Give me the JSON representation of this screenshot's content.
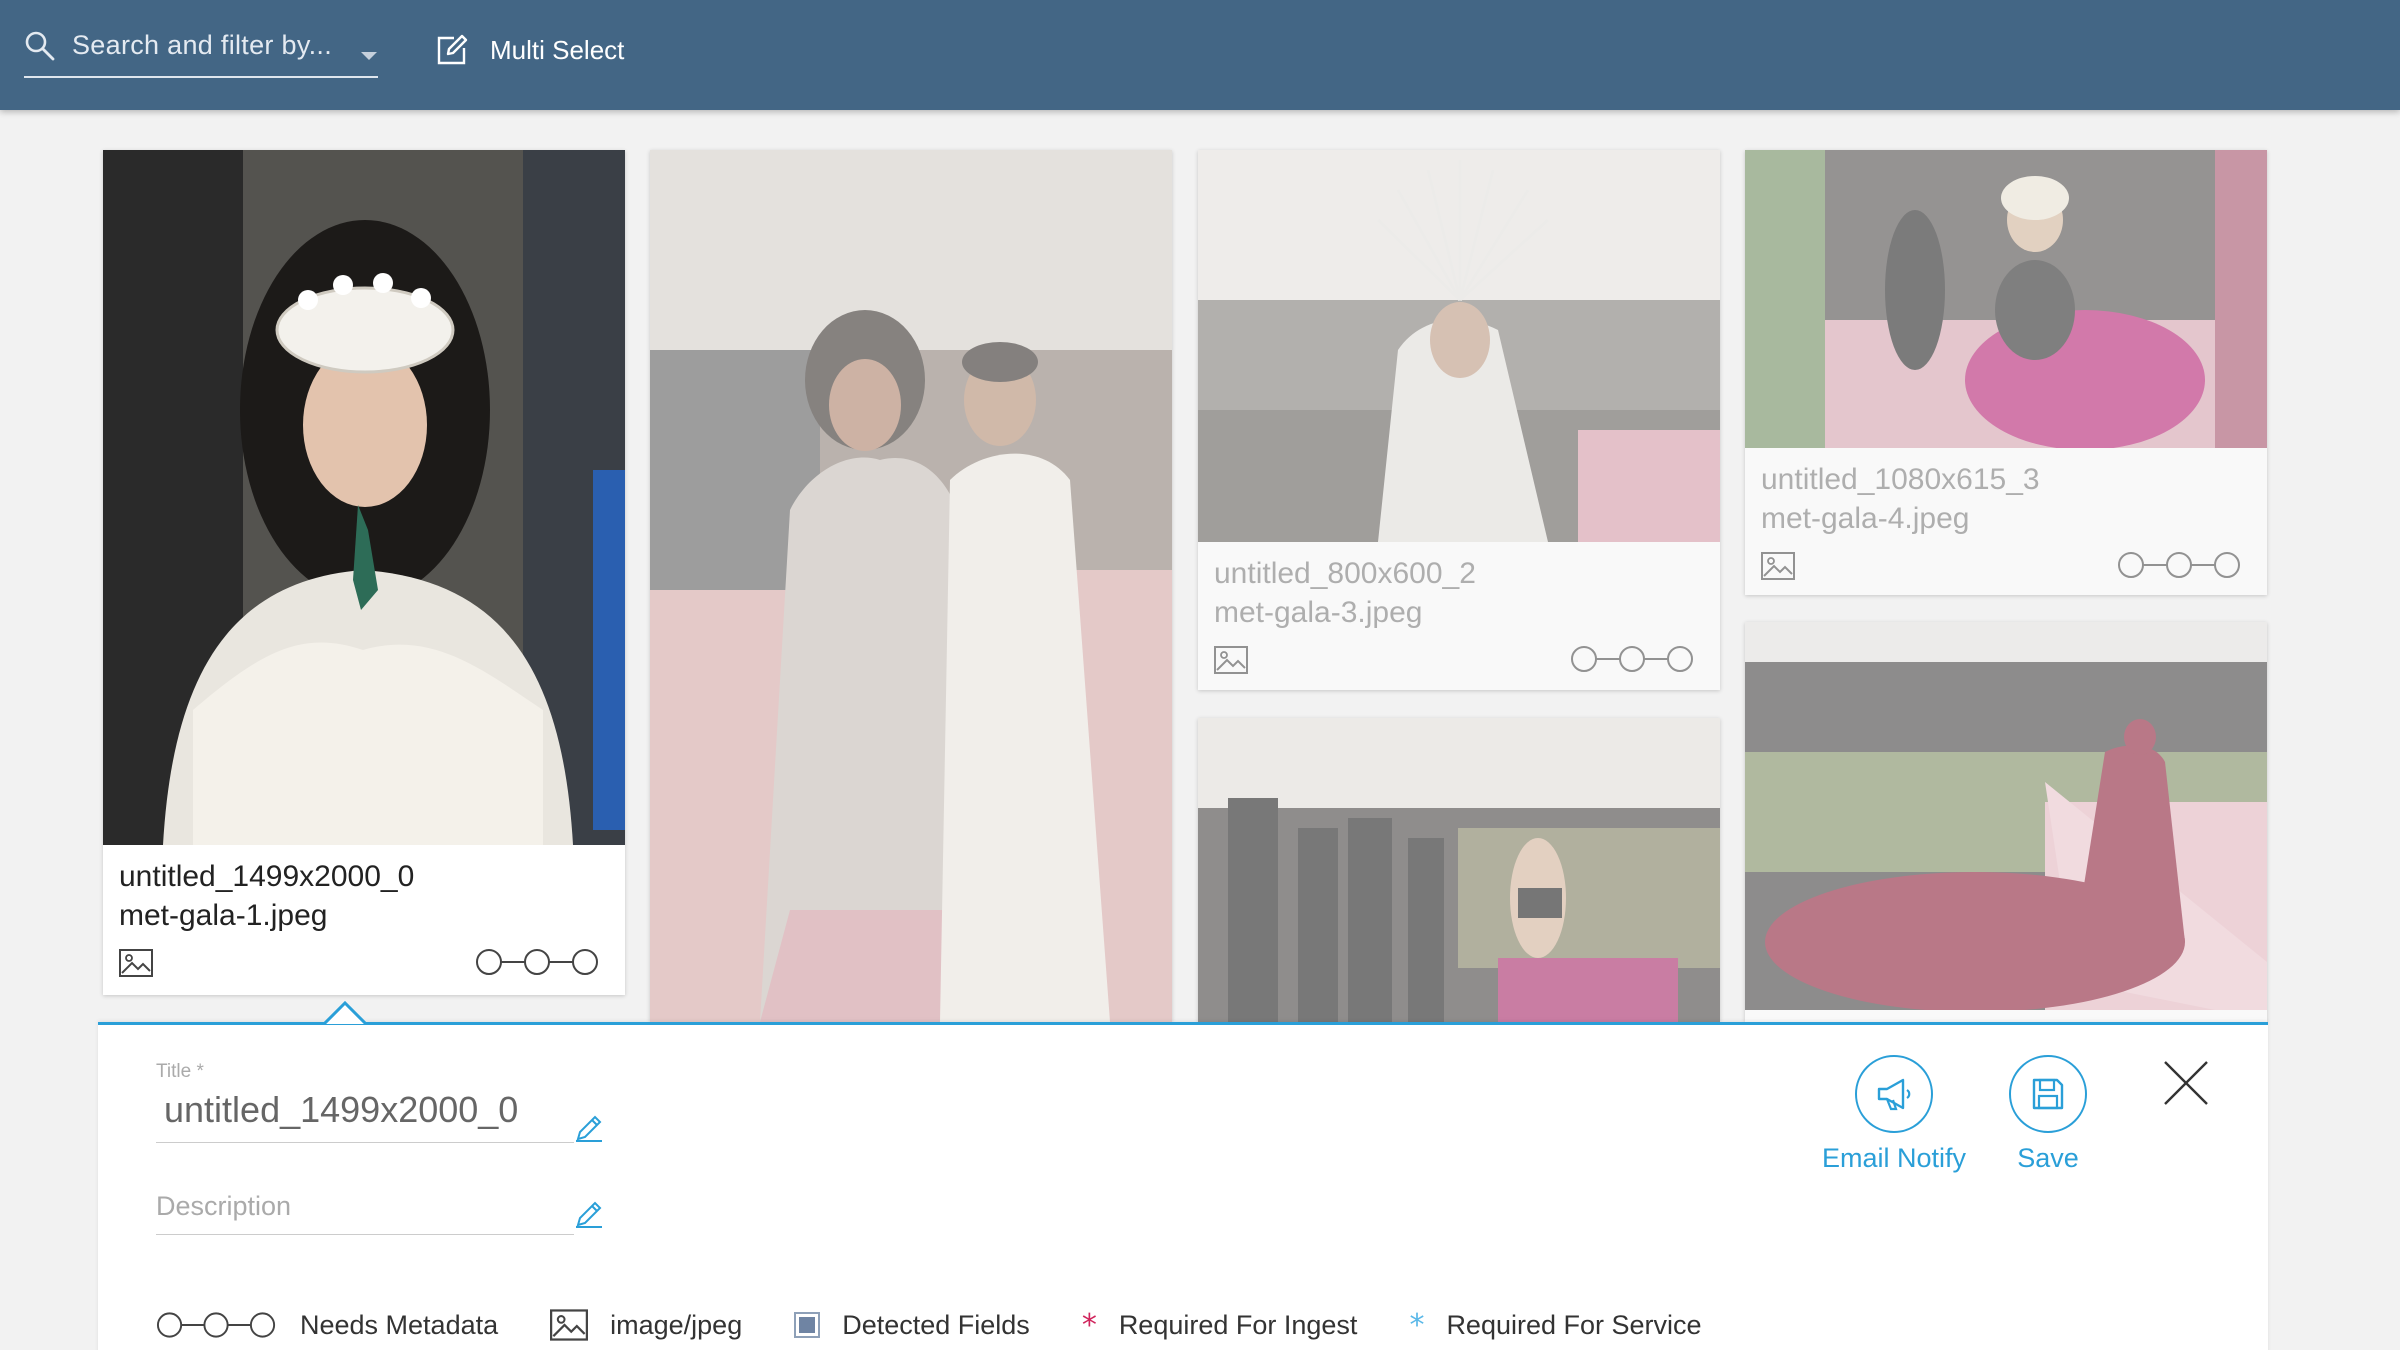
{
  "search": {
    "placeholder": "Search and filter by..."
  },
  "toolbar": {
    "multi_select_label": "Multi Select"
  },
  "cards": [
    {
      "title": "untitled_1499x2000_0",
      "filename": "met-gala-1.jpeg",
      "selected": true
    },
    {
      "title": "",
      "filename": ""
    },
    {
      "title": "untitled_800x600_2",
      "filename": "met-gala-3.jpeg"
    },
    {
      "title": "untitled_1080x615_3",
      "filename": "met-gala-4.jpeg"
    },
    {
      "title": "",
      "filename": ""
    },
    {
      "title": "",
      "filename": ""
    }
  ],
  "detail": {
    "title_label": "Title *",
    "title_value": "untitled_1499x2000_0",
    "description_placeholder": "Description",
    "email_notify_label": "Email Notify",
    "save_label": "Save"
  },
  "legend": {
    "needs_metadata": "Needs Metadata",
    "mime_type": "image/jpeg",
    "detected_fields": "Detected Fields",
    "required_ingest": "Required For Ingest",
    "required_service": "Required For Service"
  },
  "colors": {
    "topbar": "#436685",
    "accent": "#2a9fd8",
    "required_ingest_star": "#d0245c",
    "required_service_star": "#5ab8e8"
  }
}
